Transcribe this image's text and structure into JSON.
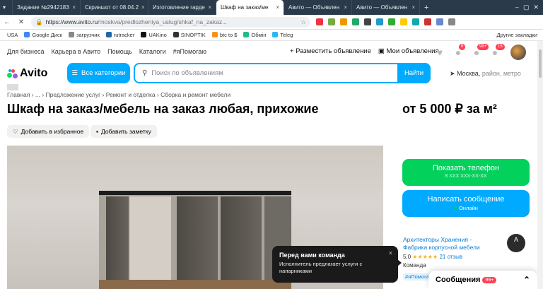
{
  "browser": {
    "tabs": [
      {
        "label": "Задание №2942183",
        "color": "#c94bd6"
      },
      {
        "label": "Скриншот от 08.04.2",
        "color": "#3a7bd5"
      },
      {
        "label": "Изготовление гарде",
        "color": "#ffffff"
      },
      {
        "label": "Шкаф на заказ/ме",
        "color": "#ffffff",
        "active": true
      },
      {
        "label": "Авито — Объявлен",
        "color": "#ffffff"
      },
      {
        "label": "Авито — Объявлен",
        "color": "#ffffff"
      }
    ],
    "new_tab": "+",
    "url_domain": "https://www.avito.ru",
    "url_path": "/moskva/predlozheniya_uslug/shkaf_na_zakaz...",
    "bookmarks": [
      "USA",
      "Google Диск",
      "загрузчик",
      "rutracker",
      "UAKino",
      "SINOPTIK",
      "btc to $",
      "Обмін",
      "Teleg"
    ],
    "bookmarks_other": "Другие закладки"
  },
  "header": {
    "links": [
      "Для бизнеса",
      "Карьера в Авито",
      "Помощь",
      "Каталоги",
      "#яПомогаю"
    ],
    "post_ad": "Разместить объявление",
    "my_ads": "Мои объявления",
    "badges": {
      "notifications": "6",
      "messages": "99+",
      "cart": "15"
    }
  },
  "logo": "Avito",
  "categories_button": "Все категории",
  "search": {
    "placeholder": "Поиск по объявлениям",
    "button": "Найти"
  },
  "location": {
    "city": "Москва,",
    "hint": "район, метро"
  },
  "breadcrumbs": "Главная › ... › Предложение услуг › Ремонт и отделка › Сборка и ремонт мебели",
  "listing": {
    "title": "Шкаф на заказ/мебель на заказ любая, прихожие",
    "price": "от 5 000 ₽ за м²",
    "add_favorite": "Добавить в избранное",
    "add_note": "Добавить заметку"
  },
  "actions": {
    "show_phone": "Показать телефон",
    "phone_mask": "8 XXX XXX-XX-XX",
    "write_message": "Написать сообщение",
    "online": "Онлайн"
  },
  "seller": {
    "name": "Архитекторы Хранения - Фабрика корпусной мебели",
    "rating": "5,0",
    "stars": "★★★★★",
    "reviews": "21 отзыв",
    "type": "Команда",
    "tag": "#яПомогаю"
  },
  "tooltip": {
    "title": "Перед вами команда",
    "text": "Исполнитель предлагает услуги с напарниками",
    "close": "×"
  },
  "messages_bar": {
    "label": "Сообщения",
    "count": "99+"
  }
}
